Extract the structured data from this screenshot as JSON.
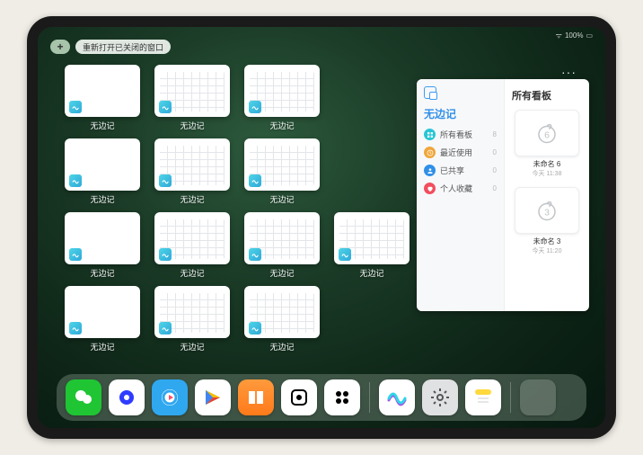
{
  "statusbar": {
    "wifi": "wifi",
    "battery": "100%"
  },
  "top": {
    "plus": "+",
    "reopen_label": "重新打开已关闭的窗口"
  },
  "app_name": "无边记",
  "grid": [
    {
      "preview": "blank"
    },
    {
      "preview": "cal"
    },
    {
      "preview": "cal"
    },
    {
      "preview": "blank"
    },
    {
      "preview": "cal"
    },
    {
      "preview": "cal"
    },
    {
      "preview": "blank"
    },
    {
      "preview": "cal"
    },
    {
      "preview": "cal"
    },
    {
      "preview": "cal"
    },
    {
      "preview": "blank"
    },
    {
      "preview": "cal"
    },
    {
      "preview": "cal"
    }
  ],
  "panel": {
    "ellipsis": "···",
    "left_title": "无边记",
    "right_title": "所有看板",
    "items": [
      {
        "icon": "grid",
        "color": "#29c6d6",
        "label": "所有看板",
        "count": 8
      },
      {
        "icon": "clock",
        "color": "#f0a63c",
        "label": "最近使用",
        "count": 0
      },
      {
        "icon": "person",
        "color": "#2f8fe8",
        "label": "已共享",
        "count": 0
      },
      {
        "icon": "heart",
        "color": "#f24e5e",
        "label": "个人收藏",
        "count": 0
      }
    ],
    "boards": [
      {
        "digit": "6",
        "name": "未命名 6",
        "time": "今天 11:38"
      },
      {
        "digit": "3",
        "name": "未命名 3",
        "time": "今天 11:20"
      }
    ]
  },
  "dock": [
    {
      "name": "wechat",
      "bg": "#20c534"
    },
    {
      "name": "quark",
      "bg": "#ffffff"
    },
    {
      "name": "youku",
      "bg": "#2fa8f0"
    },
    {
      "name": "play",
      "bg": "#ffffff"
    },
    {
      "name": "books",
      "bg": "linear-gradient(#ff9a3c,#ff7a1a)"
    },
    {
      "name": "dice",
      "bg": "#ffffff"
    },
    {
      "name": "grid4",
      "bg": "#ffffff"
    },
    {
      "name": "freeform",
      "bg": "#ffffff"
    },
    {
      "name": "settings",
      "bg": "#e0e1e3"
    },
    {
      "name": "notes",
      "bg": "#ffffff"
    }
  ]
}
